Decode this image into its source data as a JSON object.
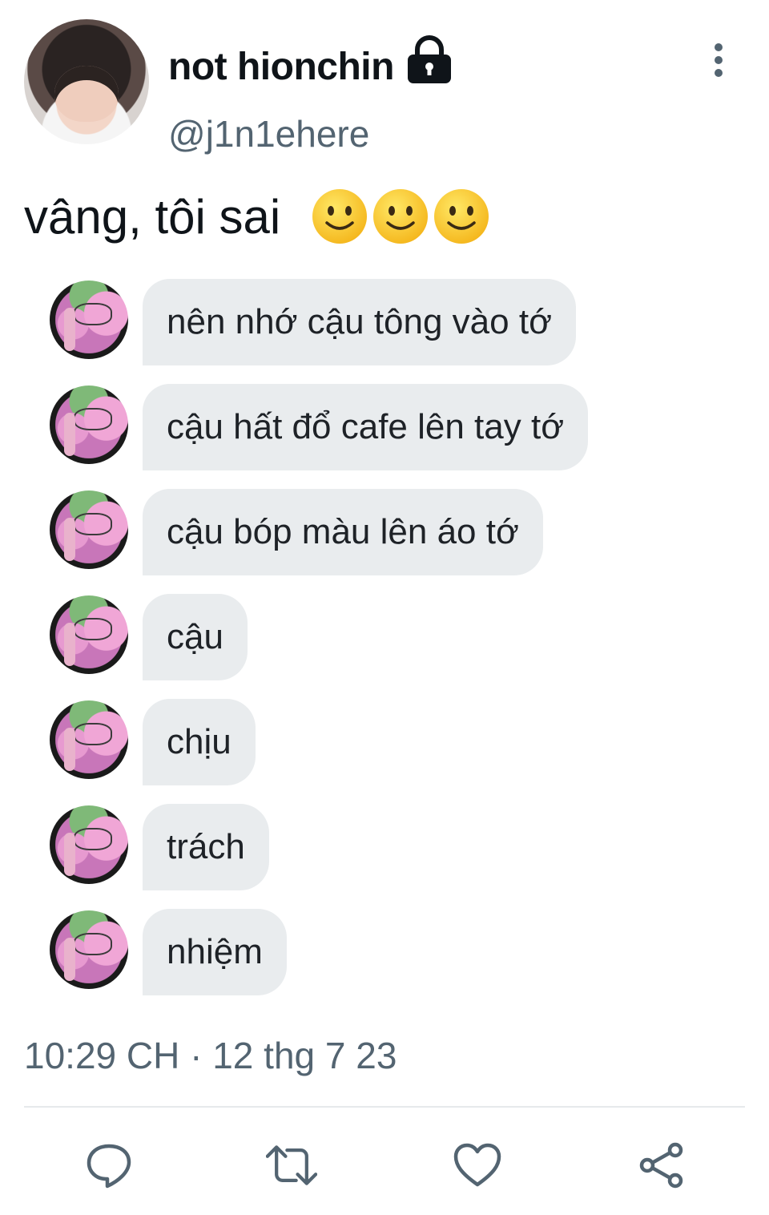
{
  "author": {
    "display_name": "not hionchin",
    "handle": "@j1n1ehere",
    "locked_icon": "lock-icon"
  },
  "tweet": {
    "text": "vâng, tôi sai",
    "emojis": [
      "slightly-smiling-face",
      "slightly-smiling-face",
      "slightly-smiling-face"
    ],
    "timestamp": "10:29 CH · 12 thg 7 23"
  },
  "chat_messages": [
    "nên nhớ cậu tông vào tớ",
    "cậu hất đổ cafe lên tay tớ",
    "cậu bóp màu lên áo tớ",
    "cậu",
    "chịu",
    "trách",
    "nhiệm"
  ],
  "actions": [
    "reply-icon",
    "retweet-icon",
    "like-icon",
    "share-icon"
  ],
  "colors": {
    "text": "#0f1419",
    "secondary": "#536471",
    "bubble": "#e9ecee"
  }
}
